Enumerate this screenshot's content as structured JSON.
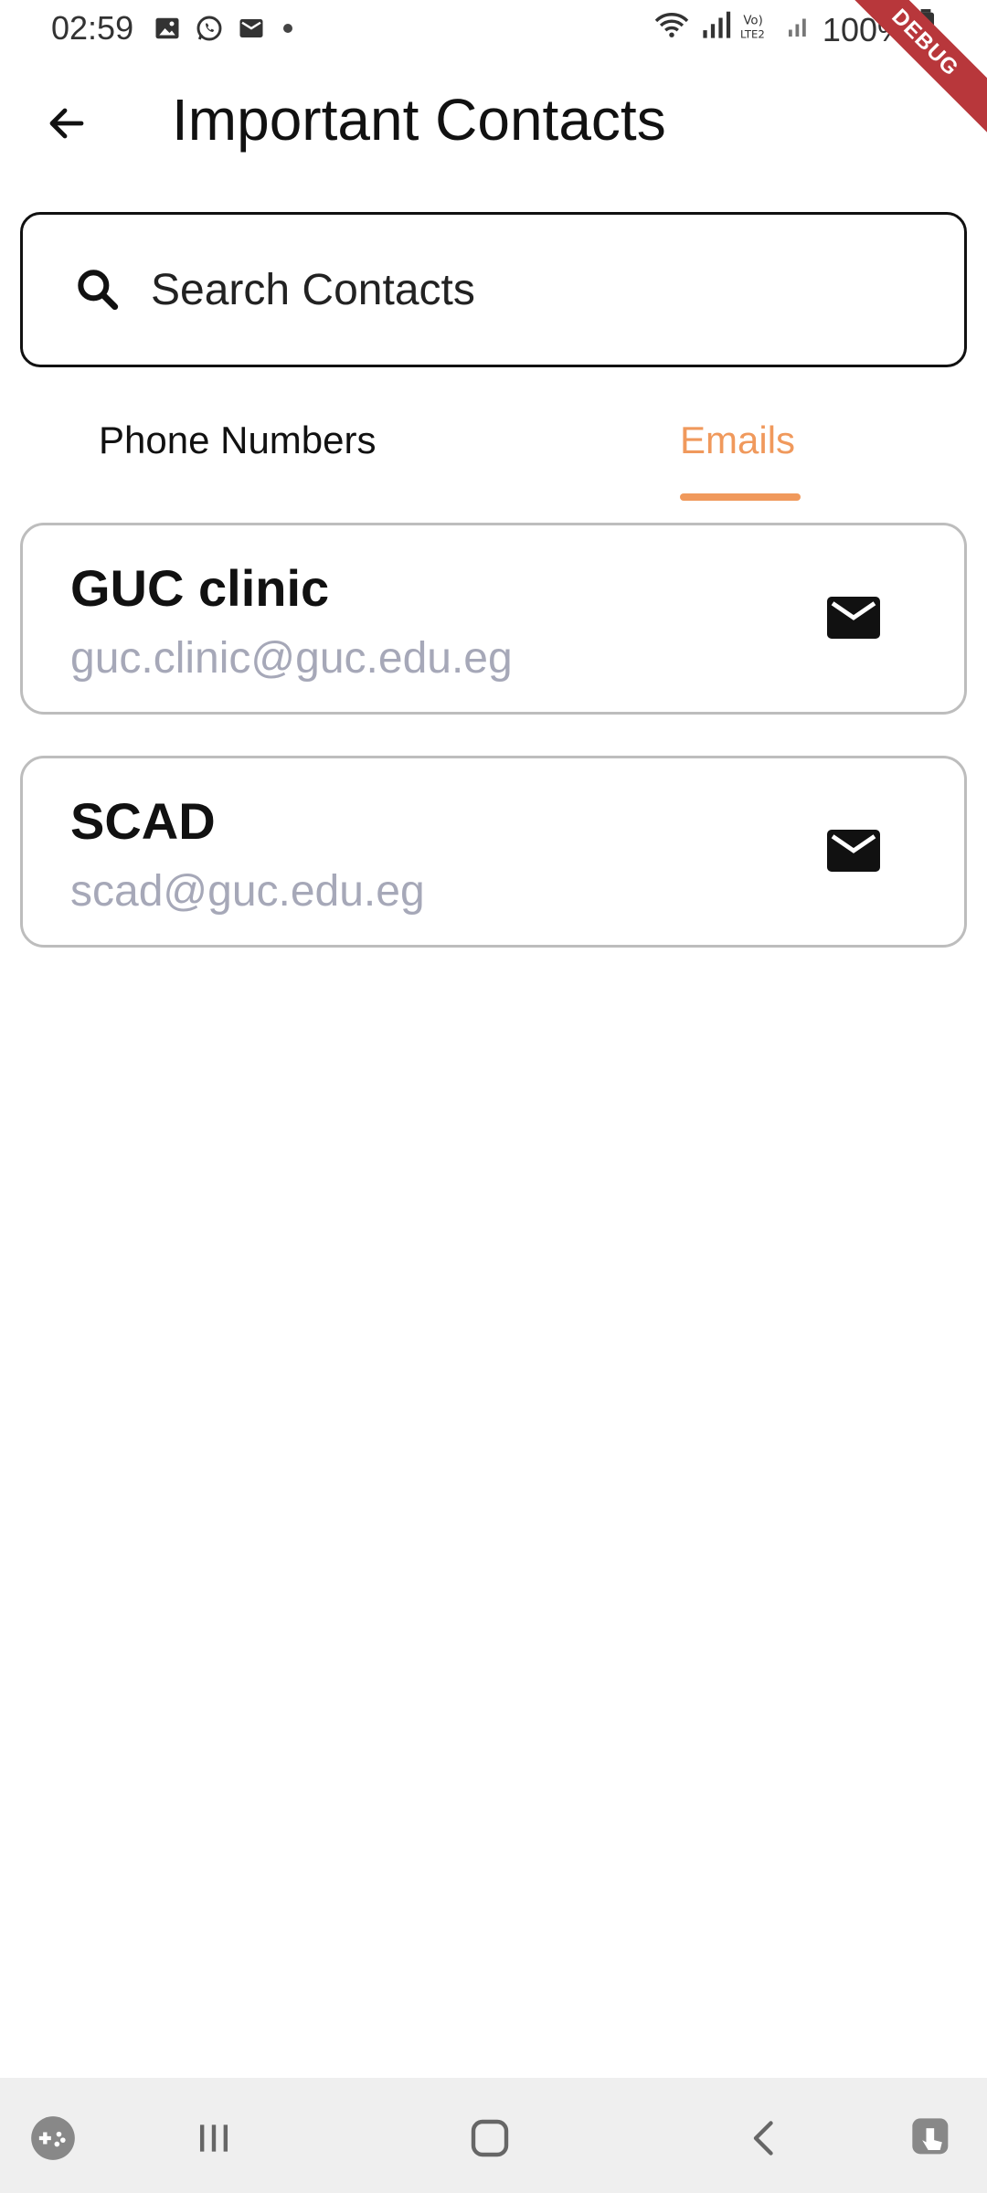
{
  "status_bar": {
    "time": "02:59",
    "battery": "100%",
    "left_icons": [
      "gallery-icon",
      "whatsapp-icon",
      "email-icon",
      "notification-dot"
    ],
    "right_icons": [
      "wifi-icon",
      "signal-icon",
      "volte-icon",
      "signal-icon",
      "battery-icon"
    ]
  },
  "debug_ribbon": "DEBUG",
  "app_bar": {
    "title": "Important Contacts"
  },
  "search": {
    "placeholder": "Search Contacts",
    "value": ""
  },
  "tabs": [
    {
      "label": "Phone Numbers",
      "selected": false
    },
    {
      "label": "Emails",
      "selected": true
    }
  ],
  "contacts": [
    {
      "name": "GUC clinic",
      "email": "guc.clinic@guc.edu.eg"
    },
    {
      "name": "SCAD",
      "email": "scad@guc.edu.eg"
    }
  ],
  "colors": {
    "accent": "#f0995c",
    "email_text": "#a6a8b8",
    "card_border": "#bdbdbd",
    "nav_background": "#efefef"
  },
  "nav": {
    "items": [
      "game-launcher-icon",
      "recent-apps-icon",
      "home-icon",
      "back-icon",
      "accessibility-icon"
    ]
  }
}
